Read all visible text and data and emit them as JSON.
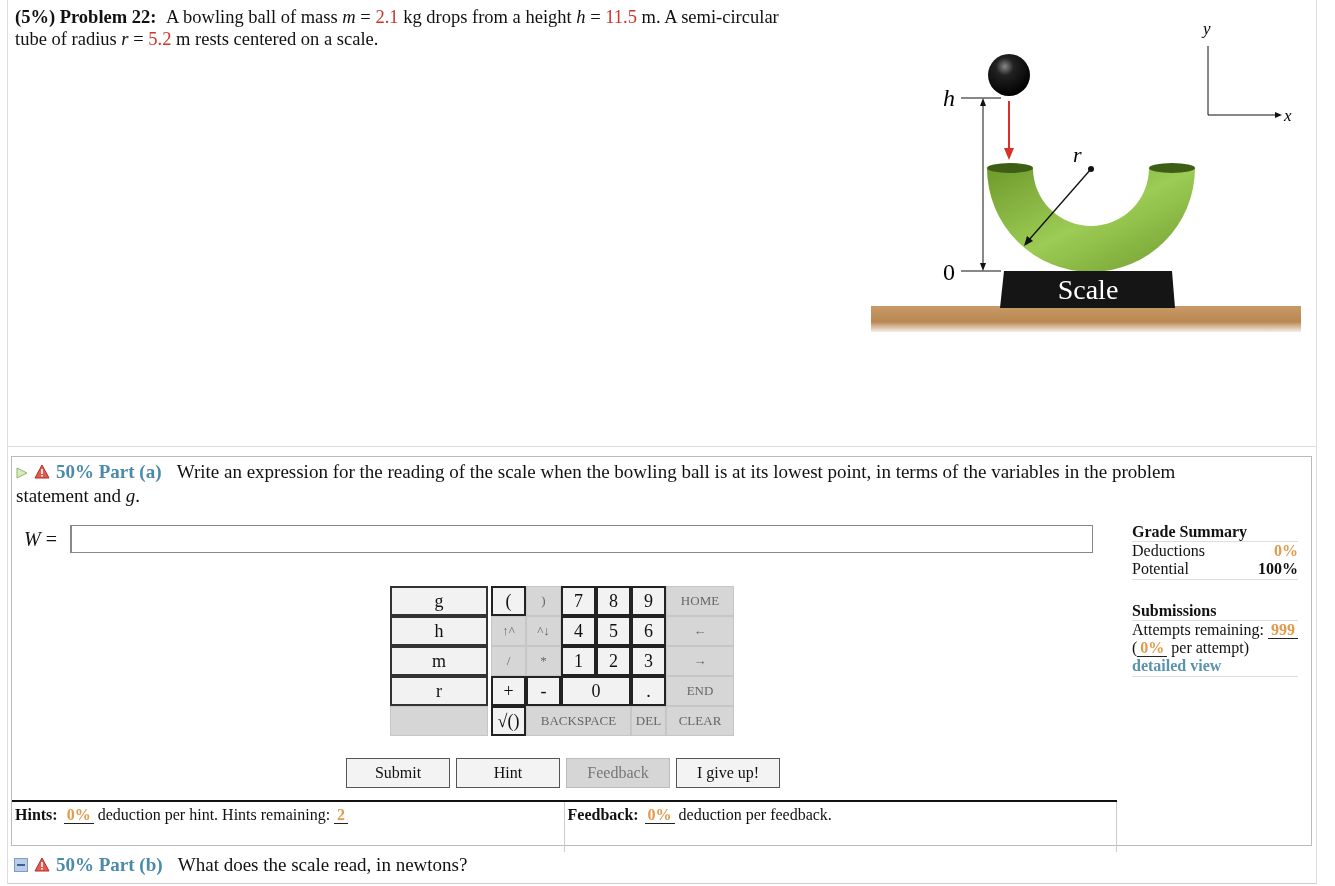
{
  "problem": {
    "label": "(5%) Problem 22:",
    "statement": [
      {
        "kind": "text",
        "text": "A bowling ball of mass "
      },
      {
        "kind": "var",
        "text": "m"
      },
      {
        "kind": "text",
        "text": " = "
      },
      {
        "kind": "value",
        "text": "2.1"
      },
      {
        "kind": "text",
        "text": " kg drops from a height "
      },
      {
        "kind": "var",
        "text": "h"
      },
      {
        "kind": "text",
        "text": " = "
      },
      {
        "kind": "value",
        "text": "11.5"
      },
      {
        "kind": "text",
        "text": " m. A semi-circular tube of radius "
      },
      {
        "kind": "var",
        "text": "r"
      },
      {
        "kind": "text",
        "text": " = "
      },
      {
        "kind": "value",
        "text": "5.2"
      },
      {
        "kind": "text",
        "text": " m rests centered on a scale."
      }
    ]
  },
  "diagram": {
    "labels": {
      "height": "h",
      "ground": "0",
      "radius": "r",
      "y_axis": "y",
      "x_axis": "x",
      "scale": "Scale"
    }
  },
  "part_a": {
    "active": true,
    "weight": "50%",
    "label": "Part (a)",
    "question": "Write an expression for the reading of the scale when the bowling ball is at its lowest point, in terms of the variables in the problem statement and *g*.",
    "answer": {
      "variable": "W",
      "operator": "="
    },
    "keypad": {
      "variables": [
        {
          "label": "g",
          "disabled": false
        },
        {
          "label": "h",
          "disabled": false
        },
        {
          "label": "m",
          "disabled": false
        },
        {
          "label": "r",
          "disabled": false
        },
        {
          "disabled": true
        }
      ],
      "keys": [
        {
          "label": "(",
          "disabled": false
        },
        {
          "label": ")",
          "disabled": true
        },
        {
          "label": "7",
          "disabled": false
        },
        {
          "label": "8",
          "disabled": false
        },
        {
          "label": "9",
          "disabled": false
        },
        {
          "label": "HOME",
          "disabled": true
        },
        {
          "label": "↑^",
          "disabled": true
        },
        {
          "label": "^↓",
          "disabled": true
        },
        {
          "label": "4",
          "disabled": false
        },
        {
          "label": "5",
          "disabled": false
        },
        {
          "label": "6",
          "disabled": false
        },
        {
          "label": "←",
          "disabled": true
        },
        {
          "label": "/",
          "disabled": true
        },
        {
          "label": "*",
          "disabled": true
        },
        {
          "label": "1",
          "disabled": false
        },
        {
          "label": "2",
          "disabled": false
        },
        {
          "label": "3",
          "disabled": false
        },
        {
          "label": "→",
          "disabled": true
        },
        {
          "label": "+",
          "disabled": false
        },
        {
          "label": "-",
          "disabled": false
        },
        {
          "label": "0",
          "disabled": false,
          "kind": "double"
        },
        {
          "label": ".",
          "disabled": false
        },
        {
          "label": "END",
          "disabled": true
        },
        {
          "label": "√()",
          "disabled": false
        },
        {
          "label": "BACKSPACE",
          "disabled": true,
          "kind": "triple"
        },
        {
          "label": "DEL",
          "disabled": true
        },
        {
          "label": "CLEAR",
          "disabled": true
        }
      ]
    },
    "buttons": [
      {
        "label": "Submit",
        "disabled": false
      },
      {
        "label": "Hint",
        "disabled": false
      },
      {
        "label": "Feedback",
        "disabled": true
      },
      {
        "label": "I give up!",
        "disabled": false
      }
    ],
    "hints": [
      {
        "kind": "bold",
        "text": "Hints:"
      },
      {
        "kind": "stat",
        "text": "0%"
      },
      {
        "kind": "text",
        "text": " deduction per hint. Hints remaining: "
      },
      {
        "kind": "stat",
        "text": "2"
      }
    ],
    "feedback": [
      {
        "kind": "bold",
        "text": "Feedback:"
      },
      {
        "kind": "stat",
        "text": "0%"
      },
      {
        "kind": "text",
        "text": " deduction per feedback."
      }
    ],
    "grade_summary": {
      "title": "Grade Summary",
      "rows": [
        {
          "label": "Deductions",
          "value": "0%",
          "kind": "deduction"
        },
        {
          "label": "Potential",
          "value": "100%",
          "kind": "potential"
        }
      ]
    },
    "submissions": {
      "title": "Submissions",
      "attempts": [
        {
          "kind": "text",
          "text": "Attempts remaining: "
        },
        {
          "kind": "stat",
          "text": "999"
        }
      ],
      "per_attempt": [
        {
          "kind": "text",
          "text": "("
        },
        {
          "kind": "stat",
          "text": "0%"
        },
        {
          "kind": "text",
          "text": " per attempt)"
        }
      ],
      "link": "detailed view"
    }
  },
  "part_b": {
    "active": false,
    "weight": "50%",
    "label": "Part (b)",
    "question": "What does the scale read, in newtons?"
  }
}
